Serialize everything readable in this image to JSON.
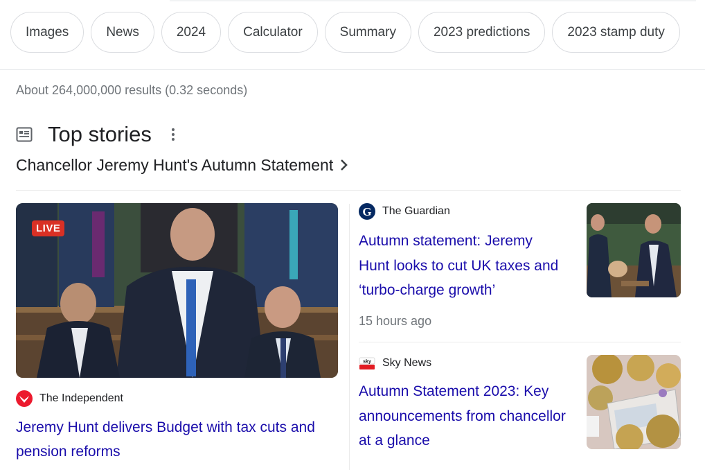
{
  "chips": [
    {
      "label": "Images"
    },
    {
      "label": "News"
    },
    {
      "label": "2024"
    },
    {
      "label": "Calculator"
    },
    {
      "label": "Summary"
    },
    {
      "label": "2023 predictions"
    },
    {
      "label": "2023 stamp duty"
    }
  ],
  "result_stats": "About 264,000,000 results (0.32 seconds)",
  "top_stories": {
    "title": "Top stories",
    "topic": "Chancellor Jeremy Hunt's Autumn Statement"
  },
  "main_story": {
    "badge": "LIVE",
    "source": "The Independent",
    "headline": "Jeremy Hunt delivers Budget with tax cuts and pension reforms"
  },
  "side_stories": [
    {
      "source": "The Guardian",
      "headline": "Autumn statement: Jeremy Hunt looks to cut UK taxes and ‘turbo-charge growth’",
      "time": "15 hours ago"
    },
    {
      "source": "Sky News",
      "headline": "Autumn Statement 2023: Key announcements from chancellor at a glance"
    }
  ],
  "icons": {
    "top_stories": "newspaper-icon",
    "more": "more-vert-icon",
    "chevron": "chevron-right-icon",
    "independent": "independent-eagle-logo",
    "guardian": "guardian-g-logo",
    "sky": "sky-news-logo"
  },
  "colors": {
    "link": "#1a0dab",
    "live_badge": "#d93025",
    "muted": "#70757a"
  }
}
